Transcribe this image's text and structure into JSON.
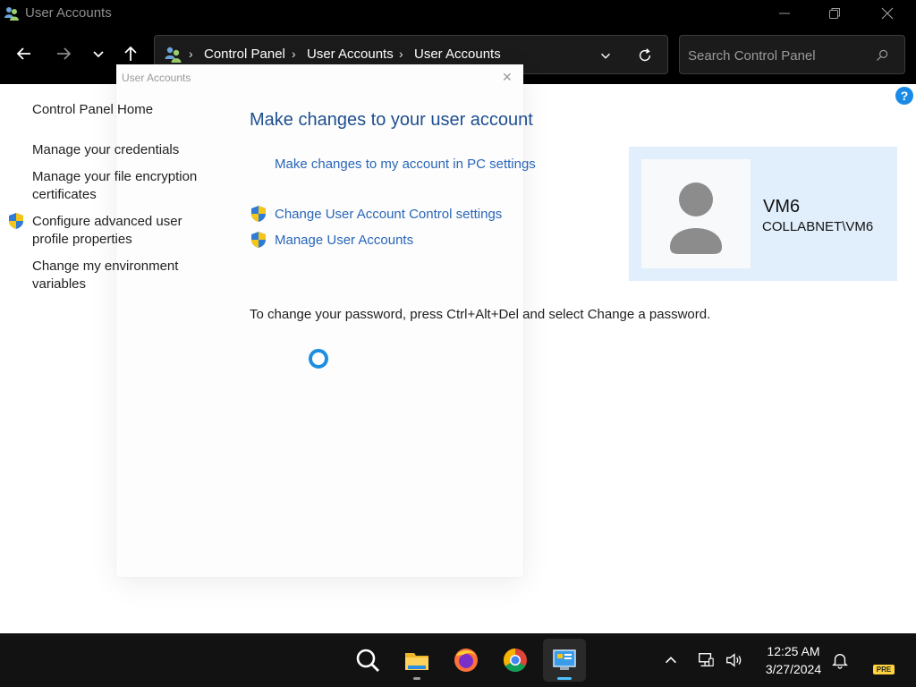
{
  "window": {
    "title": "User Accounts",
    "icon": "user-accounts-icon",
    "controls": {
      "minimize": "minimize-icon",
      "restore": "restore-icon",
      "close": "close-icon"
    }
  },
  "nav": {
    "back_icon": "arrow-left-icon",
    "forward_icon": "arrow-right-icon",
    "recent_icon": "chevron-down-icon",
    "up_icon": "arrow-up-icon"
  },
  "address": {
    "breadcrumbs": [
      "Control Panel",
      "User Accounts",
      "User Accounts"
    ],
    "separator": "›"
  },
  "search": {
    "placeholder": "Search Control Panel",
    "value": ""
  },
  "help": {
    "label": "?"
  },
  "ghost_dialog": {
    "title": "User Accounts",
    "close": "✕"
  },
  "sidebar": {
    "items": [
      {
        "label": "Control Panel Home"
      },
      {
        "label": "Manage your credentials"
      },
      {
        "label": "Manage your file encryption certificates"
      },
      {
        "label": "Configure advanced user profile properties",
        "icon": "uac-shield-icon"
      },
      {
        "label": "Change my environment variables"
      }
    ]
  },
  "main": {
    "heading": "Make changes to your user account",
    "links": [
      {
        "label": "Make changes to my account in PC settings"
      },
      {
        "label": "Change User Account Control settings",
        "icon": "uac-shield-icon"
      },
      {
        "label": "Manage User Accounts",
        "icon": "uac-shield-icon"
      }
    ],
    "info": "To change your password, press Ctrl+Alt+Del and select Change a password."
  },
  "account": {
    "name": "VM6",
    "domain": "COLLABNET\\VM6",
    "avatar_icon": "default-user-avatar-icon"
  },
  "taskbar": {
    "apps": [
      "search-icon",
      "file-explorer-icon",
      "firefox-icon",
      "chrome-icon",
      "control-panel-icon"
    ],
    "tray": [
      "show-hidden-icons-icon",
      "network-icon",
      "volume-icon",
      "notification-bell-icon"
    ],
    "time": "12:25 AM",
    "date": "3/27/2024",
    "badge": "PRE"
  },
  "colors": {
    "heading": "#1e4f8f",
    "link": "#2966b8",
    "account_card": "#e1eefc",
    "spinner": "#1e8ee0"
  }
}
